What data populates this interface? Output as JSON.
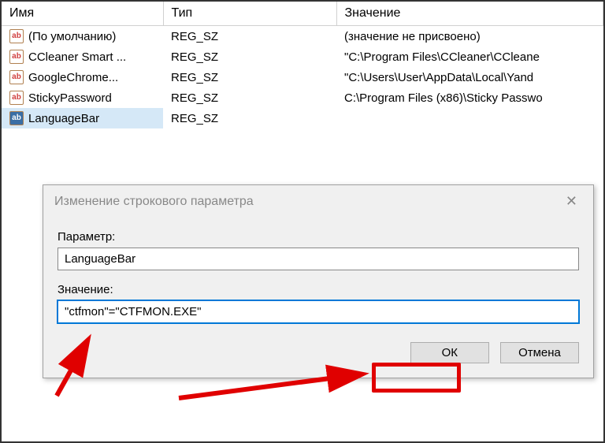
{
  "columns": {
    "name": "Имя",
    "type": "Тип",
    "value": "Значение"
  },
  "rows": [
    {
      "name": "(По умолчанию)",
      "type": "REG_SZ",
      "value": "(значение не присвоено)",
      "selected": false
    },
    {
      "name": "CCleaner Smart ...",
      "type": "REG_SZ",
      "value": "\"C:\\Program Files\\CCleaner\\CCleane",
      "selected": false
    },
    {
      "name": "GoogleChrome...",
      "type": "REG_SZ",
      "value": "\"C:\\Users\\User\\AppData\\Local\\Yand",
      "selected": false
    },
    {
      "name": "StickyPassword",
      "type": "REG_SZ",
      "value": "C:\\Program Files (x86)\\Sticky Passwo",
      "selected": false
    },
    {
      "name": "LanguageBar",
      "type": "REG_SZ",
      "value": "",
      "selected": true
    }
  ],
  "dialog": {
    "title": "Изменение строкового параметра",
    "paramLabel": "Параметр:",
    "paramValue": "LanguageBar",
    "valueLabel": "Значение:",
    "valueValue": "\"ctfmon\"=\"CTFMON.EXE\"",
    "ok": "ОК",
    "cancel": "Отмена"
  }
}
